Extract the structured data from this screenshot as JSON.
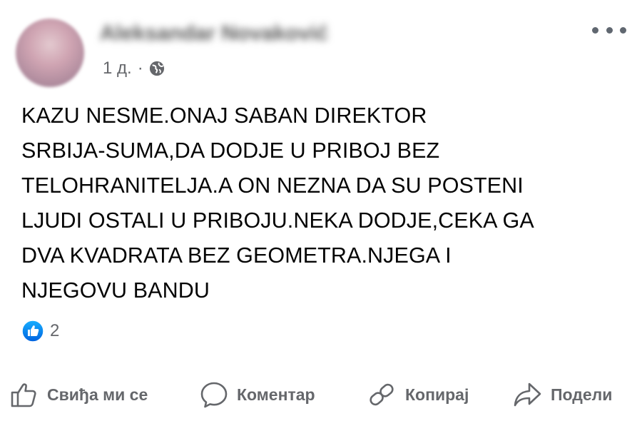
{
  "post": {
    "author_name": "Aleksandar Novaković",
    "time": "1 д.",
    "separator": "·",
    "audience_icon": "globe-icon",
    "more_icon": "more-options-icon",
    "text_lines": [
      "KAZU NESME.ONAJ SABAN DIREKTOR",
      "SRBIJA-SUMA,DA DODJE U PRIBOJ BEZ",
      "TELOHRANITELJA.A ON NEZNA DA SU POSTENI",
      "LJUDI OSTALI U PRIBOJU.NEKA DODJE,CEKA GA",
      "DVA KVADRATA BEZ GEOMETRA.NJEGA I",
      "NJEGOVU BANDU"
    ],
    "reaction_count": "2"
  },
  "actions": {
    "like": "Свиђа ми се",
    "comment": "Коментар",
    "copy": "Копирај",
    "share": "Подели"
  },
  "colors": {
    "like_blue": "#1877f2",
    "secondary_text": "#65676b",
    "primary_text": "#050505"
  }
}
